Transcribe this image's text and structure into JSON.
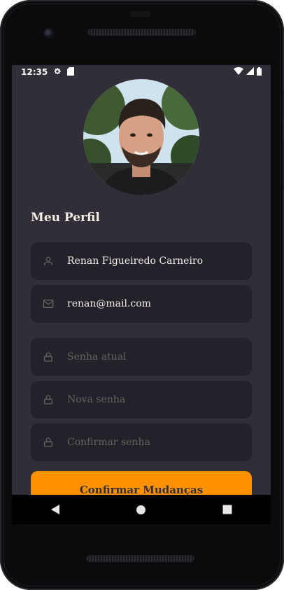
{
  "status_bar": {
    "time": "12:35",
    "left_icons": [
      "gear-icon",
      "sd-card-icon"
    ],
    "right_icons": [
      "wifi-icon",
      "signal-icon",
      "battery-icon"
    ]
  },
  "profile": {
    "title": "Meu Perfil",
    "avatar": "profile-photo"
  },
  "form": {
    "name": {
      "value": "Renan Figueiredo Carneiro",
      "icon": "user-icon"
    },
    "email": {
      "value": "renan@mail.com",
      "icon": "mail-icon"
    },
    "current_password": {
      "placeholder": "Senha atual",
      "icon": "lock-icon"
    },
    "new_password": {
      "placeholder": "Nova senha",
      "icon": "lock-icon"
    },
    "confirm_password": {
      "placeholder": "Confirmar senha",
      "icon": "lock-icon"
    },
    "submit_label": "Confirmar Mudanças"
  },
  "nav_bar": {
    "buttons": [
      "back-icon",
      "home-icon",
      "recents-icon"
    ]
  },
  "colors": {
    "background": "#312e38",
    "field_background": "#232129",
    "accent": "#ff9000",
    "text": "#f4ede8",
    "placeholder": "#666360"
  }
}
